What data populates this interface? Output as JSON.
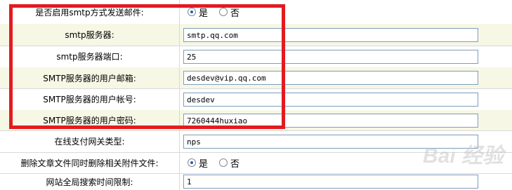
{
  "settings": [
    {
      "label": "是否启用smtp方式发送邮件:",
      "type": "radio",
      "options": [
        "是",
        "否"
      ],
      "selected": 0
    },
    {
      "label": "smtp服务器:",
      "type": "input",
      "value": "smtp.qq.com"
    },
    {
      "label": "smtp服务器端口:",
      "type": "input",
      "value": "25"
    },
    {
      "label": "SMTP服务器的用户邮箱:",
      "type": "input",
      "value": "desdev@vip.qq.com"
    },
    {
      "label": "SMTP服务器的用户帐号:",
      "type": "input",
      "value": "desdev"
    },
    {
      "label": "SMTP服务器的用户密码:",
      "type": "input",
      "value": "7260444huxiao"
    },
    {
      "label": "在线支付网关类型:",
      "type": "input",
      "value": "nps"
    },
    {
      "label": "删除文章文件同时删除相关附件文件:",
      "type": "radio",
      "options": [
        "是",
        "否"
      ],
      "selected": 0
    },
    {
      "label": "网站全局搜索时间限制:",
      "type": "input",
      "value": "1"
    }
  ],
  "watermark": "Bai 经验",
  "colors": {
    "highlight": "#e21b1f",
    "label_bg": "#f7f7e6"
  }
}
